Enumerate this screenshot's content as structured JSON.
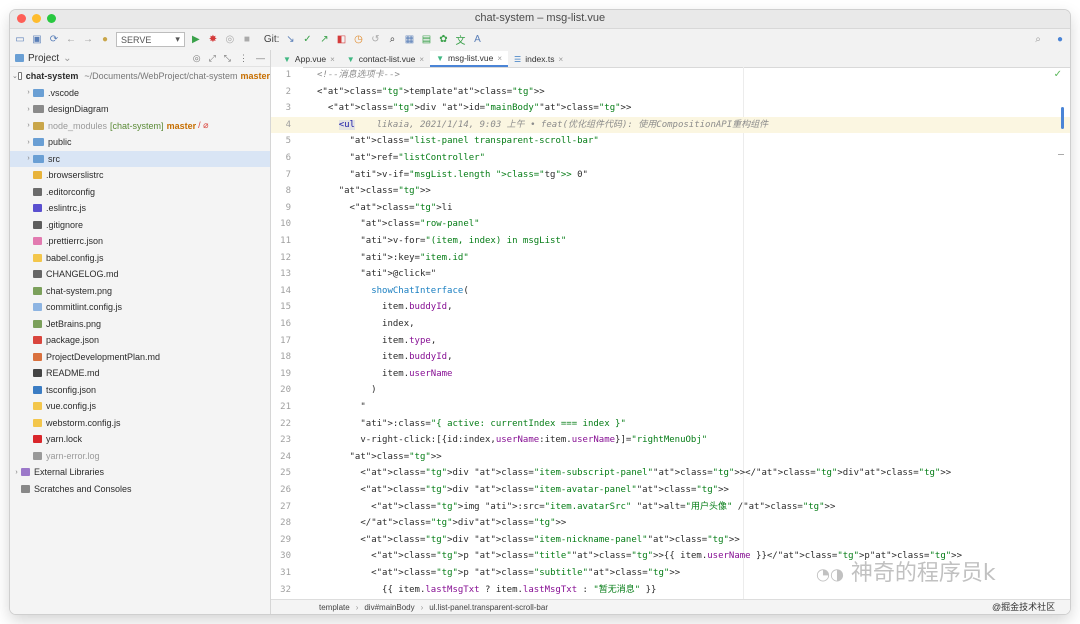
{
  "window": {
    "title": "chat-system – msg-list.vue"
  },
  "toolbar": {
    "run_config": "SERVE",
    "git_label": "Git:"
  },
  "project": {
    "label": "Project",
    "root_name": "chat-system",
    "root_path": "~/Documents/WebProject/chat-system",
    "root_branch": "master",
    "items": [
      {
        "name": ".vscode",
        "kind": "folder",
        "expand": "›",
        "color": "#6a9fd4"
      },
      {
        "name": "designDiagram",
        "kind": "folder",
        "expand": "›",
        "color": "#8a8a8a"
      },
      {
        "name": "node_modules",
        "extra": "[chat-system]",
        "branch": "master",
        "ext2": "/ ⌀",
        "kind": "folder",
        "expand": "›",
        "color": "#c9a64a",
        "dim": true
      },
      {
        "name": "public",
        "kind": "folder",
        "expand": "›",
        "color": "#6a9fd4"
      },
      {
        "name": "src",
        "kind": "folder",
        "expand": "›",
        "color": "#6a9fd4",
        "selected": true
      },
      {
        "name": ".browserslistrc",
        "kind": "file",
        "color": "#e8b33a"
      },
      {
        "name": ".editorconfig",
        "kind": "file",
        "color": "#6b6b6b"
      },
      {
        "name": ".eslintrc.js",
        "kind": "file",
        "color": "#5a4fcf"
      },
      {
        "name": ".gitignore",
        "kind": "file",
        "color": "#5d5d5d"
      },
      {
        "name": ".prettierrc.json",
        "kind": "file",
        "color": "#e27ab0"
      },
      {
        "name": "babel.config.js",
        "kind": "file",
        "color": "#f3c64b"
      },
      {
        "name": "CHANGELOG.md",
        "kind": "file",
        "color": "#666666"
      },
      {
        "name": "chat-system.png",
        "kind": "file",
        "color": "#7ba05b"
      },
      {
        "name": "commitlint.config.js",
        "kind": "file",
        "color": "#8db4e2"
      },
      {
        "name": "JetBrains.png",
        "kind": "file",
        "color": "#7ba05b"
      },
      {
        "name": "package.json",
        "kind": "file",
        "color": "#d9453d"
      },
      {
        "name": "ProjectDevelopmentPlan.md",
        "kind": "file",
        "color": "#d9703d"
      },
      {
        "name": "README.md",
        "kind": "file",
        "color": "#444444"
      },
      {
        "name": "tsconfig.json",
        "kind": "file",
        "color": "#3a7cc3"
      },
      {
        "name": "vue.config.js",
        "kind": "file",
        "color": "#f3c64b"
      },
      {
        "name": "webstorm.config.js",
        "kind": "file",
        "color": "#f3c64b"
      },
      {
        "name": "yarn.lock",
        "kind": "file",
        "color": "#d9262b"
      },
      {
        "name": "yarn-error.log",
        "kind": "file",
        "color": "#999999",
        "dim": true
      },
      {
        "name": "External Libraries",
        "kind": "lib",
        "expand": "›",
        "color": "#9b78c9"
      },
      {
        "name": "Scratches and Consoles",
        "kind": "lib",
        "color": "#888888"
      }
    ]
  },
  "tabs": [
    {
      "label": "App.vue",
      "active": false
    },
    {
      "label": "contact-list.vue",
      "active": false
    },
    {
      "label": "msg-list.vue",
      "active": true
    },
    {
      "label": "index.ts",
      "active": false
    }
  ],
  "code": [
    {
      "n": "1",
      "t": "<!--消息选项卡-->"
    },
    {
      "n": "2",
      "t": "<template>"
    },
    {
      "n": "3",
      "t": "  <div id=\"mainBody\">"
    },
    {
      "n": "4",
      "t": "    <ul    likaia, 2021/1/14, 9:03 上午 • feat(优化组件代码): 使用CompositionAPI重构组件"
    },
    {
      "n": "5",
      "t": "      class=\"list-panel transparent-scroll-bar\""
    },
    {
      "n": "6",
      "t": "      ref=\"listController\""
    },
    {
      "n": "7",
      "t": "      v-if=\"msgList.length > 0\""
    },
    {
      "n": "8",
      "t": "    >"
    },
    {
      "n": "9",
      "t": "      <li"
    },
    {
      "n": "10",
      "t": "        class=\"row-panel\""
    },
    {
      "n": "11",
      "t": "        v-for=\"(item, index) in msgList\""
    },
    {
      "n": "12",
      "t": "        :key=\"item.id\""
    },
    {
      "n": "13",
      "t": "        @click=\""
    },
    {
      "n": "14",
      "t": "          showChatInterface("
    },
    {
      "n": "15",
      "t": "            item.buddyId,"
    },
    {
      "n": "16",
      "t": "            index,"
    },
    {
      "n": "17",
      "t": "            item.type,"
    },
    {
      "n": "18",
      "t": "            item.buddyId,"
    },
    {
      "n": "19",
      "t": "            item.userName"
    },
    {
      "n": "20",
      "t": "          )"
    },
    {
      "n": "21",
      "t": "        \""
    },
    {
      "n": "22",
      "t": "        :class=\"{ active: currentIndex === index }\""
    },
    {
      "n": "23",
      "t": "        v-right-click:[{id:index,userName:item.userName}]=\"rightMenuObj\""
    },
    {
      "n": "24",
      "t": "      >"
    },
    {
      "n": "25",
      "t": "        <div class=\"item-subscript-panel\"></div>"
    },
    {
      "n": "26",
      "t": "        <div class=\"item-avatar-panel\">"
    },
    {
      "n": "27",
      "t": "          <img :src=\"item.avatarSrc\" alt=\"用户头像\" />"
    },
    {
      "n": "28",
      "t": "        </div>"
    },
    {
      "n": "29",
      "t": "        <div class=\"item-nickname-panel\">"
    },
    {
      "n": "30",
      "t": "          <p class=\"title\">{{ item.userName }}</p>"
    },
    {
      "n": "31",
      "t": "          <p class=\"subtitle\">"
    },
    {
      "n": "32",
      "t": "            {{ item.lastMsgTxt ? item.lastMsgTxt : \"暂无消息\" }}"
    }
  ],
  "breadcrumb": [
    "template",
    "div#mainBody",
    "ul.list-panel.transparent-scroll-bar"
  ],
  "watermark": {
    "text": "神奇的程序员k",
    "site": "@掘金技术社区"
  }
}
